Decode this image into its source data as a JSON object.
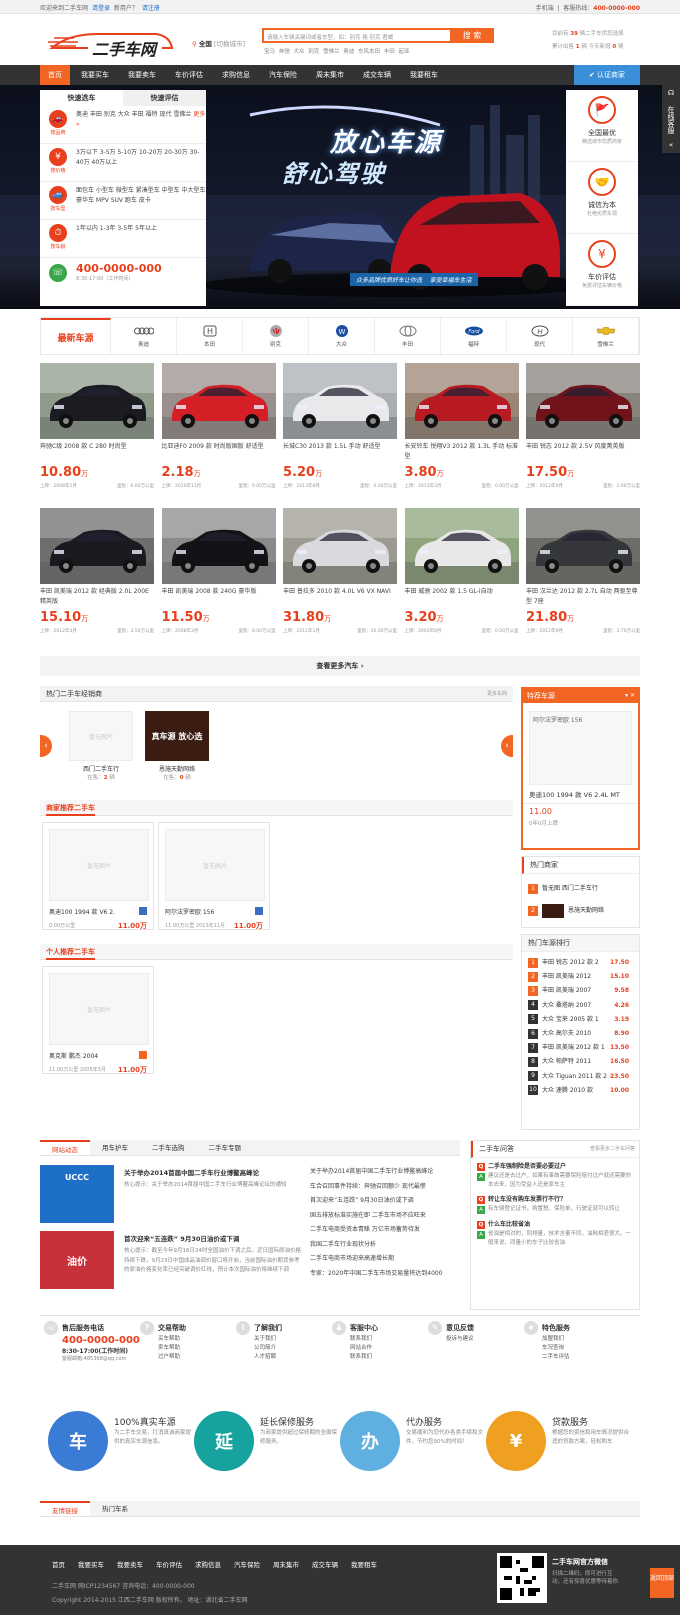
{
  "topbar": {
    "welcome": "欢迎来到二手车网",
    "login": "请登录",
    "new_user": "新用户？",
    "register": "请注册",
    "mobile": "手机端",
    "hotline_label": "客服热线：",
    "hotline": "400-0000-000"
  },
  "header": {
    "logo": "二手车网",
    "city": "全国",
    "city_switch": "[切换城市]",
    "search_placeholder": "请输入车辆关键词或者车型，如：别克 格 别克 君威",
    "search_btn": "搜 索",
    "hot_words": "宝马 奔驰 大众 别克 雪佛兰 奥迪 东风本田 丰田 起亚",
    "stat1_a": "目前有",
    "stat1_n": "39",
    "stat1_b": "辆二手车供您选择",
    "stat2_a": "累计出售",
    "stat2_n": "1",
    "stat2_b": "辆 今天新增",
    "stat2_n2": "0",
    "stat2_c": "辆"
  },
  "nav": {
    "items": [
      "首页",
      "我要买车",
      "我要卖车",
      "车价评估",
      "求购信息",
      "汽车保险",
      "周末集市",
      "成交车辆",
      "我要租车"
    ],
    "auth": "认证商家"
  },
  "quick": {
    "tab1": "快速选车",
    "tab2": "快速评估",
    "rows": [
      {
        "icon": "car-icon",
        "label": "按品牌",
        "text": "奥迪 丰田 别克 大众 丰田 福特 现代 雪佛兰",
        "more": "更多 »"
      },
      {
        "icon": "yuan-icon",
        "label": "按价格",
        "text": "3万以下 3-5万 5-10万 10-20万 20-30万 30-40万 40万以上"
      },
      {
        "icon": "car-type-icon",
        "label": "按车型",
        "text": "面包车 小型车 微型车 紧凑型车 中型车 中大型车 豪华车 MPV SUV 跑车 皮卡"
      },
      {
        "icon": "clock-icon",
        "label": "按车龄",
        "text": "1年以内 1-3年 3-5年 5年以上"
      }
    ],
    "phone": "400-0000-000",
    "hours": "8:30-17:00（工作时间）"
  },
  "banner": {
    "headline": "放心车源",
    "sub": "舒心驾驶",
    "slogan1": "众多品牌优质好车让你选",
    "slogan2": "享受幸福车生活"
  },
  "features": [
    {
      "title": "全国最优",
      "desc": "精选城市优质商家"
    },
    {
      "title": "诚信为本",
      "desc": "杜绝劣质车源"
    },
    {
      "title": "车价评估",
      "desc": "免费评估车辆价格"
    }
  ],
  "service_tab": "在线客服",
  "brands": {
    "title": "最新车源",
    "items": [
      "奥迪",
      "本田",
      "别克",
      "大众",
      "丰田",
      "福特",
      "现代",
      "雪佛兰"
    ]
  },
  "cars_row1": [
    {
      "name": "奔驰C级 2008 款 C 280 时尚型",
      "price": "10.80",
      "unit": "万",
      "date": "上牌：2008年1月",
      "mile": "里程：0.00万公里",
      "c": "#1b1b22",
      "bg": "#8e9b8a"
    },
    {
      "name": "比亚迪F0 2009 款 时尚版国版 舒适型",
      "price": "2.18",
      "unit": "万",
      "date": "上牌：2010年11月",
      "mile": "里程：0.00万公里",
      "c": "#d41f26",
      "bg": "#9a8f8c"
    },
    {
      "name": "长城C30 2013 款 1.5L 手动 舒适型",
      "price": "5.20",
      "unit": "万",
      "date": "上牌：2013年8月",
      "mile": "里程：0.00万公里",
      "c": "#e9e9ec",
      "bg": "#a9aeb3"
    },
    {
      "name": "长安铃车 悦翔V3 2012 款 1.3L 手动 标准型",
      "price": "3.80",
      "unit": "万",
      "date": "上牌：2013年3月",
      "mile": "里程：0.00万公里",
      "c": "#b81a22",
      "bg": "#9a8674"
    },
    {
      "name": "丰田 锐志 2012 款 2.5V 风度菁英版",
      "price": "17.50",
      "unit": "万",
      "date": "上牌：2012年9月",
      "mile": "里程：2.00万公里",
      "c": "#70131a",
      "bg": "#87837d"
    }
  ],
  "cars_row2": [
    {
      "name": "丰田 凯美瑞 2012 款 经典版 2.0L 200E 精英版",
      "price": "15.10",
      "unit": "万",
      "date": "上牌：2012年4月",
      "mile": "里程：3.50万公里",
      "c": "#1a1b20",
      "bg": "#6e6e6e"
    },
    {
      "name": "丰田 凯美瑞 2008 款 240G 豪华版",
      "price": "11.50",
      "unit": "万",
      "date": "上牌：2008年3月",
      "mile": "里程：8.00万公里",
      "c": "#121316",
      "bg": "#8a8a8a"
    },
    {
      "name": "丰田 普拉多 2010 款 4.0L V6 VX NAVI",
      "price": "31.80",
      "unit": "万",
      "date": "上牌：2011年1月",
      "mile": "里程：16.00万公里",
      "c": "#d9dadd",
      "bg": "#9c9a90"
    },
    {
      "name": "丰田 威驰 2002 款 1.5 GL-i自动",
      "price": "3.20",
      "unit": "万",
      "date": "上牌：2003年9月",
      "mile": "里程：0.00万公里",
      "c": "#e8e8e8",
      "bg": "#8da47c"
    },
    {
      "name": "丰田 汉兰达 2012 款 2.7L 自动 两驱至尊型 7座",
      "price": "21.80",
      "unit": "万",
      "date": "上牌：2012年9月",
      "mile": "里程：3.70万公里",
      "c": "#35373b",
      "bg": "#6f6d69"
    }
  ],
  "more_cars": "查看更多汽车 ›",
  "dealers": {
    "title": "热门二手车经销商",
    "more": "更多车商",
    "items": [
      {
        "img": "暂无图片",
        "name": "西门二手车行",
        "stock_label": "在售：",
        "stock": "2",
        "stock_unit": " 辆"
      },
      {
        "img": "真车源 放心选",
        "name": "恩施天勤网络",
        "stock_label": "在售：",
        "stock": "0",
        "stock_unit": " 辆"
      }
    ]
  },
  "merchant": {
    "title": "商家推荐二手车",
    "items": [
      {
        "name": "奥迪100 1994 款 V6 2.",
        "mile": "0.00万公里",
        "year": "",
        "price": "11.00万",
        "placeholder": "暂无图片"
      },
      {
        "name": "阿尔法罗密欧 156",
        "mile": "11.00万公里",
        "year": "2013年11月",
        "price": "11.00万",
        "placeholder": "暂无图片"
      }
    ]
  },
  "personal": {
    "title": "个人推荐二手车",
    "items": [
      {
        "name": "奥克斯 鹏杰 2004",
        "mile": "11.00万公里",
        "year": "2005年3月",
        "price": "11.00万",
        "placeholder": "暂无图片"
      }
    ]
  },
  "special": {
    "title": "特荐车源",
    "car_title": "阿尔法罗密欧 156",
    "name": "奥迪100 1994 款 V6 2.4L MT",
    "price": "11.00",
    "date": "0年0月上牌"
  },
  "hot_merchants": {
    "title": "热门商家",
    "items": [
      {
        "n": "1",
        "name": "暂无图  西门二手车行"
      },
      {
        "n": "2",
        "name": "恩施天勤网络"
      }
    ]
  },
  "rank": {
    "title": "热门车源排行",
    "items": [
      {
        "n": "1",
        "name": "丰田 锐志 2012 款 2",
        "p": "17.50"
      },
      {
        "n": "2",
        "name": "丰田 凯美瑞 2012",
        "p": "15.10"
      },
      {
        "n": "3",
        "name": "丰田 凯美瑞 2007",
        "p": "9.58"
      },
      {
        "n": "4",
        "name": "大众 桑塔纳 2007",
        "p": "4.26"
      },
      {
        "n": "5",
        "name": "大众 宝来 2005 款 1",
        "p": "3.19"
      },
      {
        "n": "6",
        "name": "大众 高尔夫 2010",
        "p": "8.90"
      },
      {
        "n": "7",
        "name": "丰田 凯美瑞 2012 款 1",
        "p": "13.50"
      },
      {
        "n": "8",
        "name": "大众 帕萨特 2011",
        "p": "16.50"
      },
      {
        "n": "9",
        "name": "大众 Tiguan 2011 款 2",
        "p": "23.50"
      },
      {
        "n": "10",
        "name": "大众 速腾 2010 款",
        "p": "10.00"
      }
    ]
  },
  "news": {
    "tabs": [
      "网站动态",
      "用车护车",
      "二手车选购",
      "二手车专题"
    ],
    "items": [
      {
        "title": "关于举办2014首届中国二手车行业博鳌高峰论",
        "desc": "核心提示：关于举办2014首届中国二手车行业博鳌高峰论坛的通知",
        "img": "UCCC"
      },
      {
        "title": "首次迎来“五连跌” 9月30日油价或下调",
        "desc": "核心提示：截至今年9月16日24时全国油价下调之后，近日国际原油价格持续下跌，9月23日中国成品油调价窗口将开启，当前国际油价期货参考的原油价格变化率已经突破调价红线，预计本次国际油价将继续下调",
        "img": "油价"
      }
    ],
    "list": [
      "关于举办2014首届中国二手车行业博鳌高峰论",
      "车合召回事件持续：奔驰召回额少 现代最惨",
      "首次迎来“五连跌” 9月30日油价或下调",
      "国五排放标准实施在即 二手车市场不应旺来",
      "二手车电商受资本青睐 万亿市场蓄势待发",
      "我国二手车行业现状分析",
      "二手车电商市场迎来高速增长期",
      "专家：2020年中国二手车市场交易量将达到4000"
    ]
  },
  "qa": {
    "title": "二手车问答",
    "more": "查看更多二手车问答",
    "items": [
      {
        "q": "二手车强制险是否要必要过户",
        "a": "建议还是去过户，如果有事故需要保险赔付过户就还需要你本去来，因为受益人还是原车主"
      },
      {
        "q": "转让车没有购车发票行不行？",
        "a": "有车辆登记证书，购置税、保险单，行驶证就可以转让"
      },
      {
        "q": "什么车比较省油",
        "a": "省油是相对的，同排量，技术含量不同，油耗相差很大。一般来说，同量小的车子比较省油"
      }
    ]
  },
  "services": [
    {
      "icon": "phone-icon",
      "title": "售后服务电话",
      "phone": "400-0000-000",
      "hours": "8:30-17:00(工作时间)",
      "mail": "客服邮箱:485368@qq.com"
    },
    {
      "icon": "question-icon",
      "title": "交易帮助",
      "items": [
        "买车帮助",
        "卖车帮助",
        "过户帮助"
      ]
    },
    {
      "icon": "info-icon",
      "title": "了解我们",
      "items": [
        "关于我们",
        "公司简介",
        "人才招聘"
      ]
    },
    {
      "icon": "user-icon",
      "title": "客服中心",
      "items": [
        "联系我们",
        "网站合作",
        "联系我们"
      ]
    },
    {
      "icon": "feedback-icon",
      "title": "意见反馈",
      "items": [
        "投诉与建议"
      ]
    },
    {
      "icon": "star-icon",
      "title": "特色服务",
      "items": [
        "加盟我们",
        "车况查询",
        "二手车评估"
      ]
    }
  ],
  "promos": [
    {
      "title": "100%真实车源",
      "desc": "为二手车交易，打消真诚商家提供的真实车源信息。",
      "glyph": "车",
      "color": "#3a7bd5"
    },
    {
      "title": "延长保修服务",
      "desc": "为商家提供超过保修期的全面保修服务。",
      "glyph": "延",
      "color": "#16a3a0"
    },
    {
      "title": "代办服务",
      "desc": "交易顺利为您代办各类手续和文件，节约您90%的时间！",
      "glyph": "办",
      "color": "#5fb0e0"
    },
    {
      "title": "贷款服务",
      "desc": "根据您的资信和用车情况提供合适的贷款方案，轻松购车",
      "glyph": "¥",
      "color": "#f0a020"
    }
  ],
  "links": {
    "tabs": [
      "友情链接",
      "热门车系"
    ]
  },
  "footer": {
    "nav": [
      "首页",
      "我要买车",
      "我要卖车",
      "车价评估",
      "求购信息",
      "汽车保险",
      "周末集市",
      "成交车辆",
      "我要租车"
    ],
    "line1": "二手车网  网ICP1234567  咨询电话：400-0000-000",
    "line2": "Copyright 2014-2015  江西二手车网 版权所有。 地址：湖北省二手车网",
    "qr_title": "二手车网官方微信",
    "qr_desc": "扫描二维码，即可进行互动，还有惊喜优惠等待着你",
    "backtop": "返回顶部"
  }
}
